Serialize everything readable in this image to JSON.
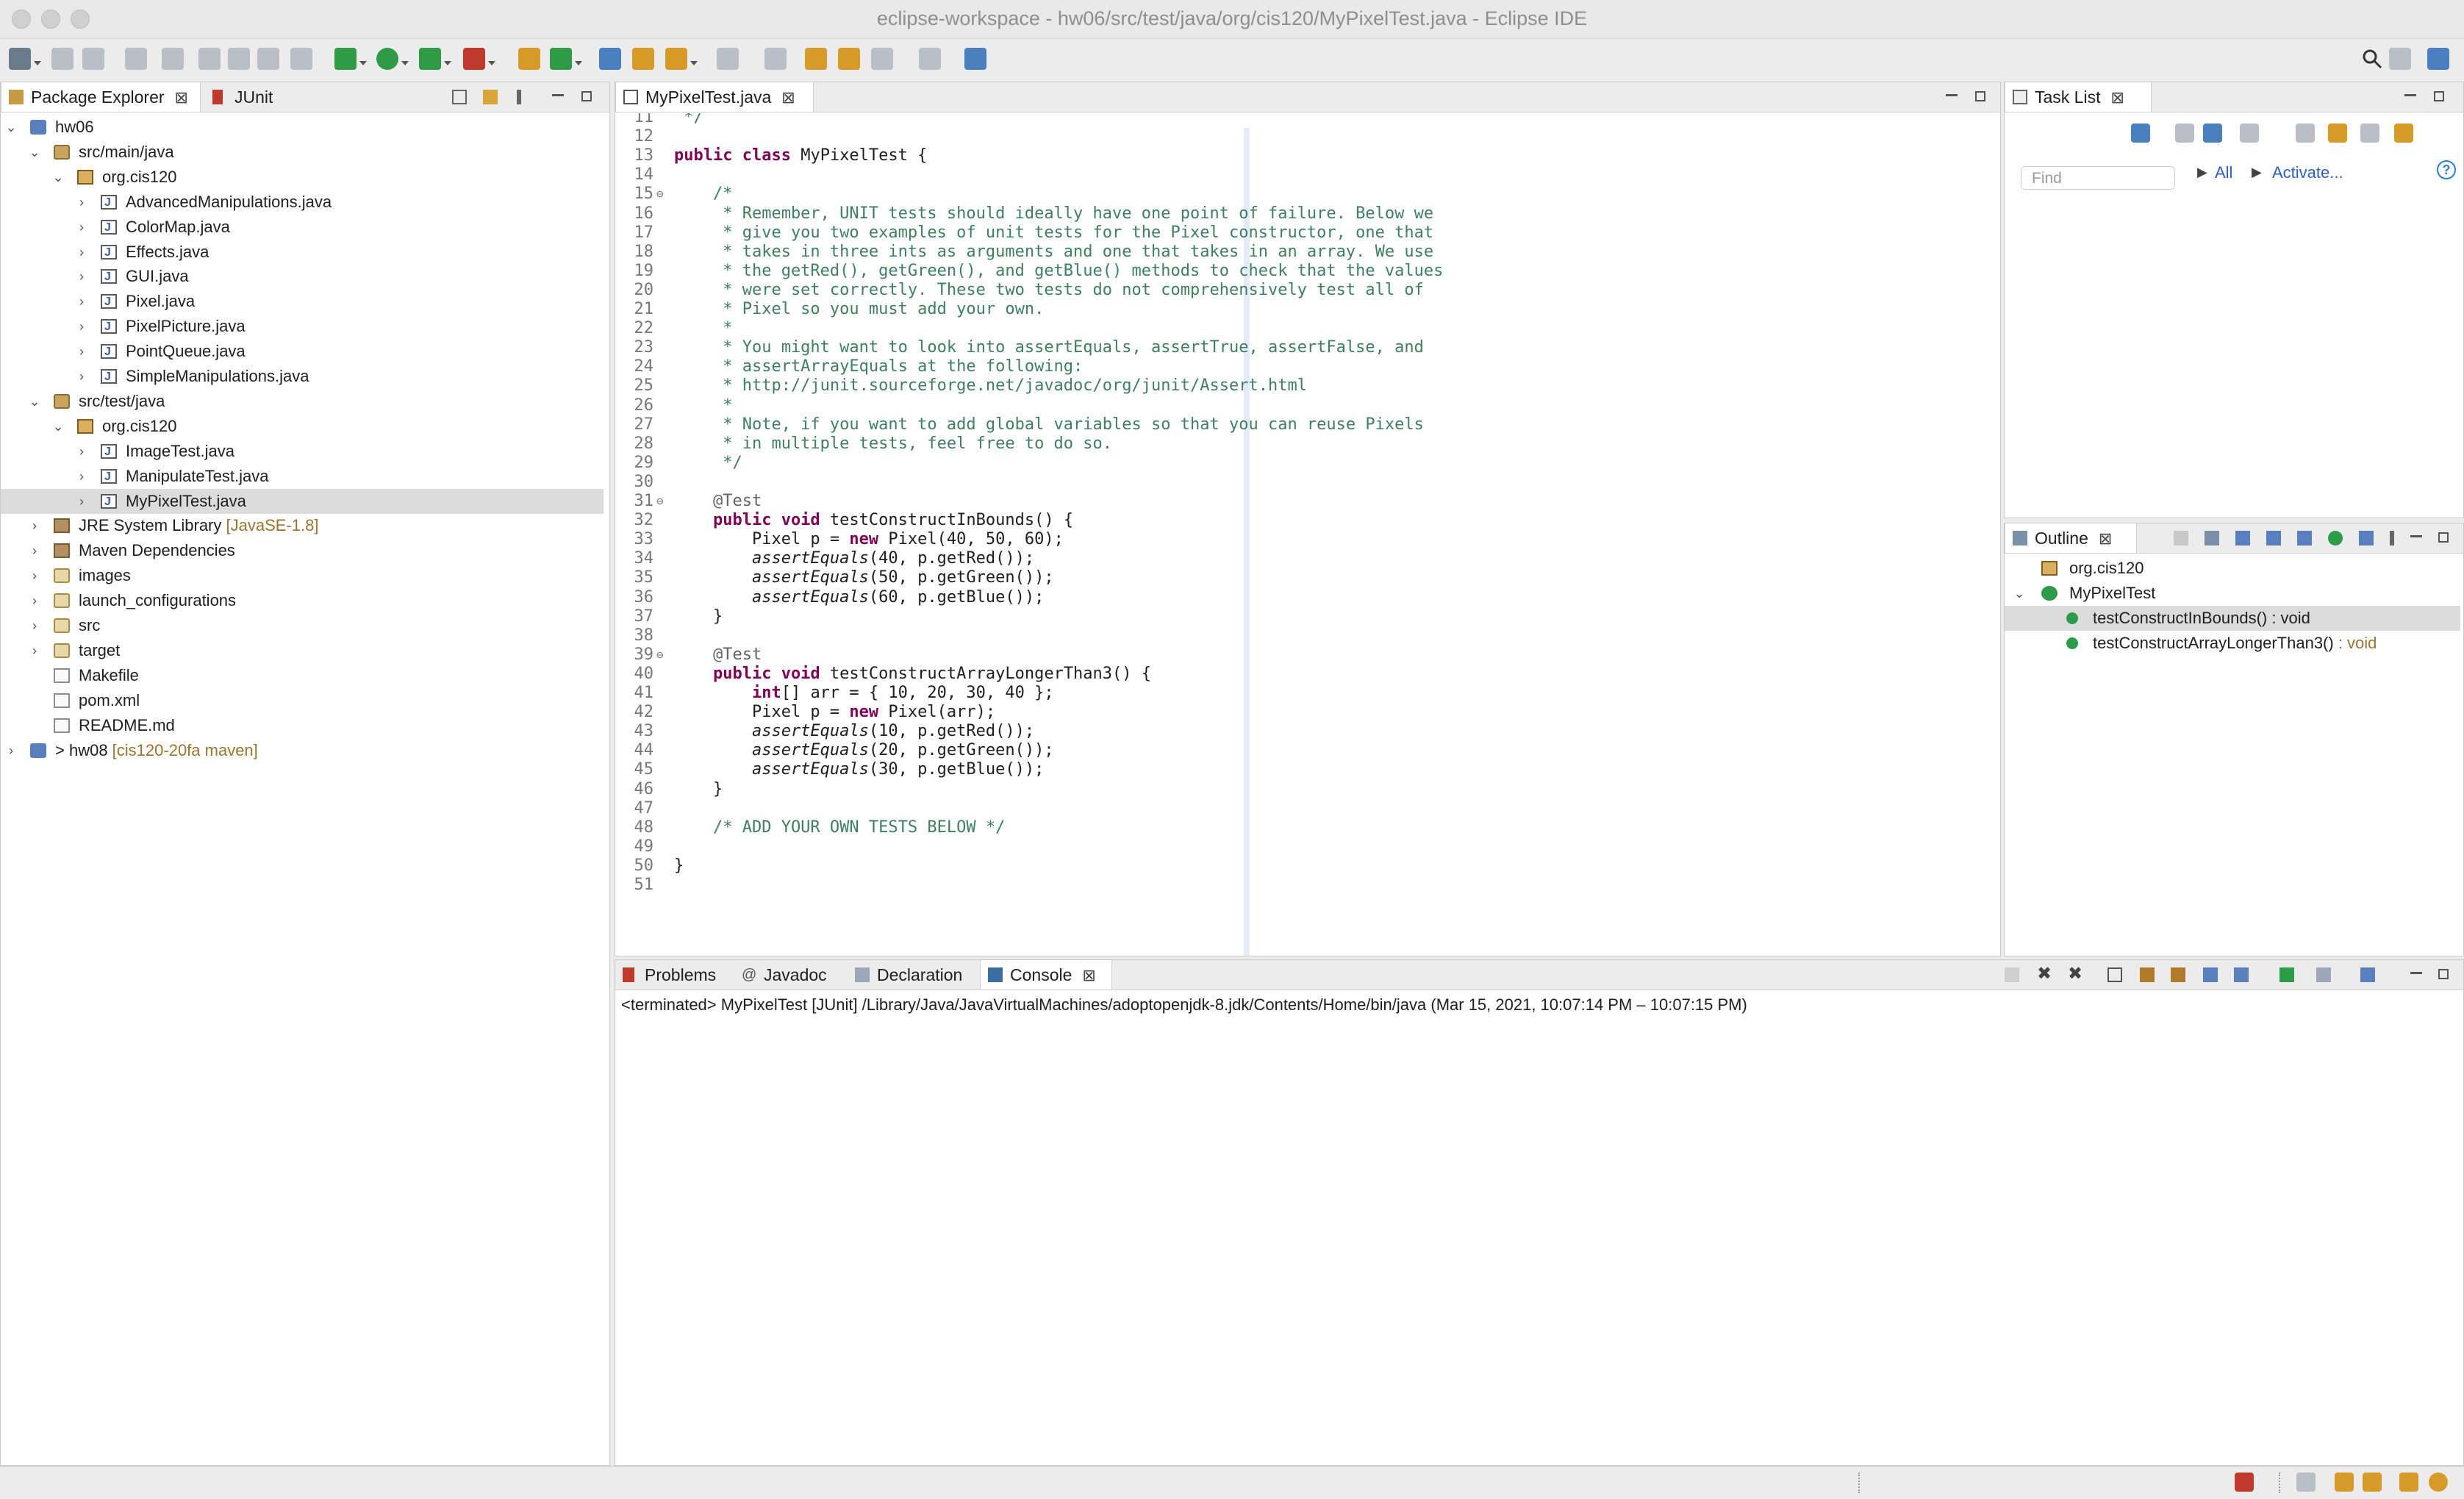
{
  "window": {
    "title": "eclipse-workspace - hw06/src/test/java/org/cis120/MyPixelTest.java - Eclipse IDE"
  },
  "package_explorer": {
    "tabs": [
      {
        "label": "Package Explorer",
        "close": "⊠"
      },
      {
        "label": "JUnit"
      }
    ],
    "tree": [
      {
        "label": "hw06",
        "icon": "project-icon",
        "twisty": "v"
      },
      {
        "label": "src/main/java",
        "icon": "source-folder-icon",
        "twisty": "v"
      },
      {
        "label": "org.cis120",
        "icon": "package-icon",
        "twisty": "v"
      },
      {
        "label": "AdvancedManipulations.java",
        "icon": "java-file-icon",
        "twisty": ">"
      },
      {
        "label": "ColorMap.java",
        "icon": "java-file-icon",
        "twisty": ">"
      },
      {
        "label": "Effects.java",
        "icon": "java-file-icon",
        "twisty": ">"
      },
      {
        "label": "GUI.java",
        "icon": "java-file-icon",
        "twisty": ">"
      },
      {
        "label": "Pixel.java",
        "icon": "java-file-icon",
        "twisty": ">"
      },
      {
        "label": "PixelPicture.java",
        "icon": "java-file-icon",
        "twisty": ">"
      },
      {
        "label": "PointQueue.java",
        "icon": "java-file-icon",
        "twisty": ">"
      },
      {
        "label": "SimpleManipulations.java",
        "icon": "java-file-icon",
        "twisty": ">"
      },
      {
        "label": "src/test/java",
        "icon": "source-folder-icon",
        "twisty": "v"
      },
      {
        "label": "org.cis120",
        "icon": "package-icon",
        "twisty": "v"
      },
      {
        "label": "ImageTest.java",
        "icon": "java-file-icon",
        "twisty": ">"
      },
      {
        "label": "ManipulateTest.java",
        "icon": "java-file-icon",
        "twisty": ">"
      },
      {
        "label": "MyPixelTest.java",
        "icon": "java-file-icon",
        "twisty": ">",
        "selected": true
      },
      {
        "label": "JRE System Library",
        "decoration": "[JavaSE-1.8]",
        "icon": "library-icon",
        "twisty": ">"
      },
      {
        "label": "Maven Dependencies",
        "icon": "library-icon",
        "twisty": ">"
      },
      {
        "label": "images",
        "icon": "folder-icon",
        "twisty": ">"
      },
      {
        "label": "launch_configurations",
        "icon": "folder-icon",
        "twisty": ">"
      },
      {
        "label": "src",
        "icon": "folder-icon",
        "twisty": ">"
      },
      {
        "label": "target",
        "icon": "folder-icon",
        "twisty": ">"
      },
      {
        "label": "Makefile",
        "icon": "file-icon",
        "twisty": ""
      },
      {
        "label": "pom.xml",
        "icon": "xml-file-icon",
        "twisty": ""
      },
      {
        "label": "README.md",
        "icon": "file-icon",
        "twisty": ""
      },
      {
        "label": "> hw08",
        "decoration": "[cis120-20fa maven]",
        "icon": "project-icon",
        "twisty": ">"
      }
    ]
  },
  "editor": {
    "tab_label": "MyPixelTest.java",
    "lines": [
      {
        "n": "11",
        "fold": "",
        "segs": [
          [
            "cm",
            " */"
          ]
        ]
      },
      {
        "n": "12",
        "fold": "",
        "segs": []
      },
      {
        "n": "13",
        "fold": "",
        "segs": [
          [
            "kw",
            "public class"
          ],
          [
            "",
            " MyPixelTest {"
          ]
        ]
      },
      {
        "n": "14",
        "fold": "",
        "segs": []
      },
      {
        "n": "15",
        "fold": "⊖",
        "segs": [
          [
            "cm",
            "    /*"
          ]
        ]
      },
      {
        "n": "16",
        "fold": "",
        "segs": [
          [
            "cm",
            "     * Remember, UNIT tests should ideally have one point of failure. Below we"
          ]
        ]
      },
      {
        "n": "17",
        "fold": "",
        "segs": [
          [
            "cm",
            "     * give you two examples of unit tests for the Pixel constructor, one that"
          ]
        ]
      },
      {
        "n": "18",
        "fold": "",
        "segs": [
          [
            "cm",
            "     * takes in three ints as arguments and one that takes in an array. We use"
          ]
        ]
      },
      {
        "n": "19",
        "fold": "",
        "segs": [
          [
            "cm",
            "     * the getRed(), getGreen(), and getBlue() methods to check that the values"
          ]
        ]
      },
      {
        "n": "20",
        "fold": "",
        "segs": [
          [
            "cm",
            "     * were set correctly. These two tests do not comprehensively test all of"
          ]
        ]
      },
      {
        "n": "21",
        "fold": "",
        "segs": [
          [
            "cm",
            "     * Pixel so you must add your own."
          ]
        ]
      },
      {
        "n": "22",
        "fold": "",
        "segs": [
          [
            "cm",
            "     *"
          ]
        ]
      },
      {
        "n": "23",
        "fold": "",
        "segs": [
          [
            "cm",
            "     * You might want to look into assertEquals, assertTrue, assertFalse, and"
          ]
        ]
      },
      {
        "n": "24",
        "fold": "",
        "segs": [
          [
            "cm",
            "     * assertArrayEquals at the following:"
          ]
        ]
      },
      {
        "n": "25",
        "fold": "",
        "segs": [
          [
            "cm",
            "     * http://junit.sourceforge.net/javadoc/org/junit/Assert.html"
          ]
        ]
      },
      {
        "n": "26",
        "fold": "",
        "segs": [
          [
            "cm",
            "     *"
          ]
        ]
      },
      {
        "n": "27",
        "fold": "",
        "segs": [
          [
            "cm",
            "     * Note, if you want to add global variables so that you can reuse Pixels"
          ]
        ]
      },
      {
        "n": "28",
        "fold": "",
        "segs": [
          [
            "cm",
            "     * in multiple tests, feel free to do so."
          ]
        ]
      },
      {
        "n": "29",
        "fold": "",
        "segs": [
          [
            "cm",
            "     */"
          ]
        ]
      },
      {
        "n": "30",
        "fold": "",
        "segs": []
      },
      {
        "n": "31",
        "fold": "⊖",
        "segs": [
          [
            "an",
            "    @Test"
          ]
        ]
      },
      {
        "n": "32",
        "fold": "",
        "segs": [
          [
            "kw",
            "    public void"
          ],
          [
            "",
            " testConstructInBounds() {"
          ]
        ]
      },
      {
        "n": "33",
        "fold": "",
        "segs": [
          [
            "",
            "        Pixel p = "
          ],
          [
            "kw",
            "new"
          ],
          [
            "",
            " Pixel(40, 50, 60);"
          ]
        ]
      },
      {
        "n": "34",
        "fold": "",
        "segs": [
          [
            "st",
            "        assertEquals"
          ],
          [
            "",
            "(40, p.getRed());"
          ]
        ]
      },
      {
        "n": "35",
        "fold": "",
        "segs": [
          [
            "st",
            "        assertEquals"
          ],
          [
            "",
            "(50, p.getGreen());"
          ]
        ]
      },
      {
        "n": "36",
        "fold": "",
        "segs": [
          [
            "st",
            "        assertEquals"
          ],
          [
            "",
            "(60, p.getBlue());"
          ]
        ]
      },
      {
        "n": "37",
        "fold": "",
        "segs": [
          [
            "",
            "    }"
          ]
        ]
      },
      {
        "n": "38",
        "fold": "",
        "segs": []
      },
      {
        "n": "39",
        "fold": "⊖",
        "segs": [
          [
            "an",
            "    @Test"
          ]
        ]
      },
      {
        "n": "40",
        "fold": "",
        "segs": [
          [
            "kw",
            "    public void"
          ],
          [
            "",
            " testConstructArrayLongerThan3() {"
          ]
        ]
      },
      {
        "n": "41",
        "fold": "",
        "segs": [
          [
            "kw",
            "        int"
          ],
          [
            "",
            "[] arr = { 10, 20, 30, 40 };"
          ]
        ]
      },
      {
        "n": "42",
        "fold": "",
        "segs": [
          [
            "",
            "        Pixel p = "
          ],
          [
            "kw",
            "new"
          ],
          [
            "",
            " Pixel(arr);"
          ]
        ]
      },
      {
        "n": "43",
        "fold": "",
        "segs": [
          [
            "st",
            "        assertEquals"
          ],
          [
            "",
            "(10, p.getRed());"
          ]
        ]
      },
      {
        "n": "44",
        "fold": "",
        "segs": [
          [
            "st",
            "        assertEquals"
          ],
          [
            "",
            "(20, p.getGreen());"
          ]
        ]
      },
      {
        "n": "45",
        "fold": "",
        "segs": [
          [
            "st",
            "        assertEquals"
          ],
          [
            "",
            "(30, p.getBlue());"
          ]
        ]
      },
      {
        "n": "46",
        "fold": "",
        "segs": [
          [
            "",
            "    }"
          ]
        ]
      },
      {
        "n": "47",
        "fold": "",
        "segs": []
      },
      {
        "n": "48",
        "fold": "",
        "segs": [
          [
            "cm",
            "    /* ADD YOUR OWN TESTS BELOW */"
          ]
        ]
      },
      {
        "n": "49",
        "fold": "",
        "segs": []
      },
      {
        "n": "50",
        "fold": "",
        "segs": [
          [
            "",
            "}"
          ]
        ]
      },
      {
        "n": "51",
        "fold": "",
        "segs": []
      }
    ]
  },
  "task_list": {
    "tab_label": "Task List",
    "find_placeholder": "Find",
    "all_label": "All",
    "activate_label": "Activate..."
  },
  "outline": {
    "tab_label": "Outline",
    "items": [
      {
        "label": "org.cis120",
        "suffix": "",
        "kind": "package"
      },
      {
        "label": "MyPixelTest",
        "suffix": "",
        "kind": "class"
      },
      {
        "label": "testConstructInBounds() : void",
        "suffix": "",
        "kind": "method",
        "selected": true
      },
      {
        "label": "testConstructArrayLongerThan3()",
        "suffix": " : void",
        "kind": "method"
      }
    ]
  },
  "bottom_panel": {
    "tabs": [
      {
        "label": "Problems"
      },
      {
        "label": "Javadoc"
      },
      {
        "label": "Declaration"
      },
      {
        "label": "Console",
        "active": true
      }
    ],
    "console_text": "<terminated> MyPixelTest [JUnit] /Library/Java/JavaVirtualMachines/adoptopenjdk-8.jdk/Contents/Home/bin/java  (Mar 15, 2021, 10:07:14 PM – 10:07:15 PM)"
  },
  "colors": {
    "keyword": "#7f0055",
    "comment": "#3f7f5f",
    "annotation": "#646464",
    "line_number": "#787878",
    "decoration": "#9a7430",
    "link": "#2b5fc4",
    "method_icon": "#2e9b4a"
  }
}
